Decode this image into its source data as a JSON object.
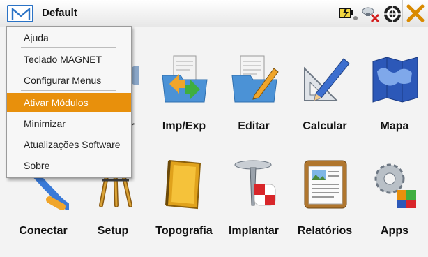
{
  "header": {
    "title": "Default",
    "icons": [
      "m-logo-icon",
      "battery-icon",
      "satellite-disconnected-icon",
      "target-icon",
      "close-icon"
    ]
  },
  "menu": {
    "items": [
      {
        "label": "Ajuda",
        "selected": false
      },
      {
        "label": "Teclado MAGNET",
        "selected": false
      },
      {
        "label": "Configurar Menus",
        "selected": false
      },
      {
        "label": "Ativar Módulos",
        "selected": true
      },
      {
        "label": "Minimizar",
        "selected": false
      },
      {
        "label": "Atualizações Software",
        "selected": false
      },
      {
        "label": "Sobre",
        "selected": false
      }
    ]
  },
  "tiles": [
    {
      "label": "rar",
      "icon": "folder-gear-icon"
    },
    {
      "label": "Imp/Exp",
      "icon": "import-export-icon"
    },
    {
      "label": "Editar",
      "icon": "edit-folder-icon"
    },
    {
      "label": "Calcular",
      "icon": "calculator-pencil-icon"
    },
    {
      "label": "Mapa",
      "icon": "map-icon"
    },
    {
      "label": "Conectar",
      "icon": "cable-icon"
    },
    {
      "label": "Setup",
      "icon": "tripod-icon"
    },
    {
      "label": "Topografia",
      "icon": "notebook-icon"
    },
    {
      "label": "Implantar",
      "icon": "stake-icon"
    },
    {
      "label": "Relatórios",
      "icon": "report-clipboard-icon"
    },
    {
      "label": "Apps",
      "icon": "apps-gears-icon"
    }
  ],
  "colors": {
    "accent": "#e8900c",
    "brand": "#2b73c6"
  }
}
